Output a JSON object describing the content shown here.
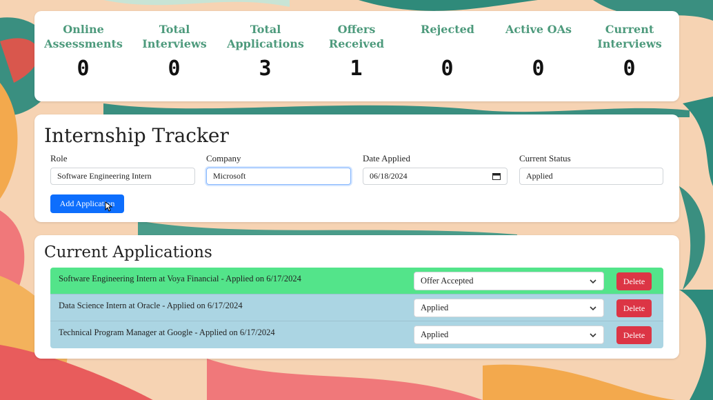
{
  "stats": [
    {
      "label": "Online Assessments",
      "value": "0"
    },
    {
      "label": "Total Interviews",
      "value": "0"
    },
    {
      "label": "Total Applications",
      "value": "3"
    },
    {
      "label": "Offers Received",
      "value": "1"
    },
    {
      "label": "Rejected",
      "value": "0"
    },
    {
      "label": "Active OAs",
      "value": "0"
    },
    {
      "label": "Current Interviews",
      "value": "0"
    }
  ],
  "tracker": {
    "title": "Internship Tracker",
    "fields": {
      "role": {
        "label": "Role",
        "value": "Software Engineering Intern"
      },
      "company": {
        "label": "Company",
        "value": "Microsoft"
      },
      "date": {
        "label": "Date Applied",
        "value": "06/18/2024"
      },
      "status": {
        "label": "Current Status",
        "value": "Applied"
      }
    },
    "add_label": "Add Application"
  },
  "applications": {
    "title": "Current Applications",
    "delete_label": "Delete",
    "items": [
      {
        "text": "Software Engineering Intern at Voya Financial - Applied on 6/17/2024",
        "status": "Offer Accepted",
        "color": "#53e48a"
      },
      {
        "text": "Data Science Intern at Oracle - Applied on 6/17/2024",
        "status": "Applied",
        "color": "#abd5e3"
      },
      {
        "text": "Technical Program Manager at Google - Applied on 6/17/2024",
        "status": "Applied",
        "color": "#abd5e3"
      }
    ]
  },
  "colors": {
    "accent": "#4d9a7c",
    "primary_button": "#0d6efd",
    "danger_button": "#dc3545",
    "offer_row": "#53e48a",
    "applied_row": "#abd5e3"
  }
}
